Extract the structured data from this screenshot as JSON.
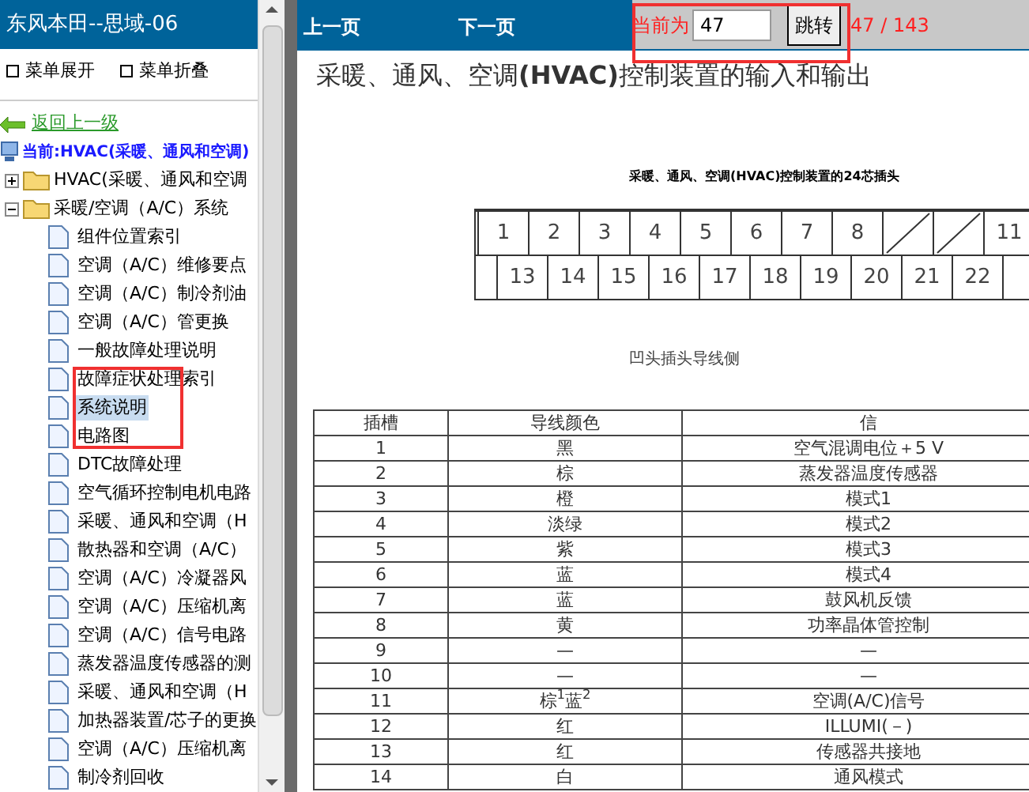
{
  "sidebar": {
    "title": "东风本田--思域-06",
    "menu_buttons": [
      "菜单展开",
      "菜单折叠"
    ],
    "back_link": "返回上一级",
    "current": "当前:HVAC(采暖、通风和空调)",
    "tree": [
      {
        "label": "HVAC(采暖、通风和空调",
        "expanded": false
      },
      {
        "label": "采暖/空调（A/C）系统",
        "expanded": true,
        "children": [
          {
            "label": "组件位置索引",
            "selected": false
          },
          {
            "label": "空调（A/C）维修要点",
            "selected": false
          },
          {
            "label": "空调（A/C）制冷剂油",
            "selected": false
          },
          {
            "label": "空调（A/C）管更换",
            "selected": false
          },
          {
            "label": "一般故障处理说明",
            "selected": false
          },
          {
            "label": "故障症状处理索引",
            "selected": false
          },
          {
            "label": "系统说明",
            "selected": true
          },
          {
            "label": "电路图",
            "selected": false
          },
          {
            "label": "DTC故障处理",
            "selected": false
          },
          {
            "label": "空气循环控制电机电路",
            "selected": false
          },
          {
            "label": "采暖、通风和空调（H",
            "selected": false
          },
          {
            "label": "散热器和空调（A/C）",
            "selected": false
          },
          {
            "label": "空调（A/C）冷凝器风",
            "selected": false
          },
          {
            "label": "空调（A/C）压缩机离",
            "selected": false
          },
          {
            "label": "空调（A/C）信号电路",
            "selected": false
          },
          {
            "label": "蒸发器温度传感器的测",
            "selected": false
          },
          {
            "label": "采暖、通风和空调（H",
            "selected": false
          },
          {
            "label": "加热器装置/芯子的更换",
            "selected": false
          },
          {
            "label": "空调（A/C）压缩机离",
            "selected": false
          },
          {
            "label": "制冷剂回收",
            "selected": false
          }
        ]
      }
    ]
  },
  "toolbar": {
    "prev": "上一页",
    "next": "下一页",
    "current_label": "当前为",
    "page_value": "47",
    "go_button": "跳转",
    "page_count": "47 / 143"
  },
  "document": {
    "title": "采暖、通风、空调**(HVAC)**控制装置的输入和输出",
    "connector_caption": "采暖、通风、空调(HVAC)控制装置的24芯插头",
    "top_pins": [
      {
        "kind": "blank"
      },
      {
        "kind": "pin",
        "label": "1"
      },
      {
        "kind": "pin",
        "label": "2"
      },
      {
        "kind": "pin",
        "label": "3"
      },
      {
        "kind": "pin",
        "label": "4"
      },
      {
        "kind": "pin",
        "label": "5"
      },
      {
        "kind": "pin",
        "label": "6"
      },
      {
        "kind": "pin",
        "label": "7"
      },
      {
        "kind": "pin",
        "label": "8"
      },
      {
        "kind": "empty"
      },
      {
        "kind": "empty"
      },
      {
        "kind": "pin",
        "label": "11"
      }
    ],
    "bottom_pins": [
      {
        "kind": "blank"
      },
      {
        "kind": "pin",
        "label": "13"
      },
      {
        "kind": "pin",
        "label": "14"
      },
      {
        "kind": "pin",
        "label": "15"
      },
      {
        "kind": "pin",
        "label": "16"
      },
      {
        "kind": "pin",
        "label": "17"
      },
      {
        "kind": "pin",
        "label": "18"
      },
      {
        "kind": "pin",
        "label": "19"
      },
      {
        "kind": "pin",
        "label": "20"
      },
      {
        "kind": "pin",
        "label": "21"
      },
      {
        "kind": "pin",
        "label": "22"
      }
    ],
    "connector_side": "凹头插头导线侧",
    "table": {
      "columns": [
        "插槽",
        "导线颜色",
        "信"
      ],
      "rows": [
        [
          "1",
          "黑",
          "空气混调电位＋5 V"
        ],
        [
          "2",
          "棕",
          "蒸发器温度传感器"
        ],
        [
          "3",
          "橙",
          "模式1"
        ],
        [
          "4",
          "淡绿",
          "模式2"
        ],
        [
          "5",
          "紫",
          "模式3"
        ],
        [
          "6",
          "蓝",
          "模式4"
        ],
        [
          "7",
          "蓝",
          "鼓风机反馈"
        ],
        [
          "8",
          "黄",
          "功率晶体管控制"
        ],
        [
          "9",
          "—",
          "—"
        ],
        [
          "10",
          "—",
          "—"
        ],
        [
          "11",
          "棕$^{1}$蓝$^{2}$",
          "空调(A/C)信号"
        ],
        [
          "12",
          "红",
          "ILLUMI(－)"
        ],
        [
          "13",
          "红",
          "传感器共接地"
        ],
        [
          "14",
          "白",
          "通风模式"
        ]
      ]
    }
  }
}
